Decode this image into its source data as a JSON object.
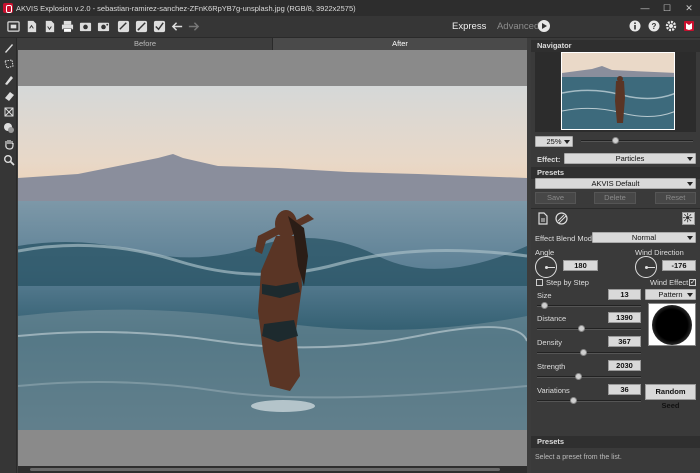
{
  "window": {
    "title": "AKVIS Explosion v.2.0 - sebastian-ramirez-sanchez-ZFnK6RpYB7g-unsplash.jpg (RGB/8, 3922x2575)"
  },
  "modes": {
    "express": "Express",
    "advanced": "Advanced"
  },
  "view_tabs": {
    "before": "Before",
    "after": "After"
  },
  "navigator": {
    "title": "Navigator",
    "zoom": "25%"
  },
  "effect": {
    "label": "Effect:",
    "value": "Particles"
  },
  "presets": {
    "title": "Presets",
    "value": "AKVIS Default",
    "save": "Save",
    "delete": "Delete",
    "reset": "Reset"
  },
  "blend": {
    "label": "Effect Blend Mode",
    "value": "Normal"
  },
  "angle": {
    "label": "Angle",
    "value": "180"
  },
  "wind_direction": {
    "label": "Wind Direction",
    "value": "-176"
  },
  "step_by_step": {
    "label": "Step by Step",
    "checked": false
  },
  "wind_effect": {
    "label": "Wind Effect",
    "checked": true
  },
  "params": {
    "size": {
      "label": "Size",
      "value": "13"
    },
    "distance": {
      "label": "Distance",
      "value": "1390"
    },
    "density": {
      "label": "Density",
      "value": "367"
    },
    "strength": {
      "label": "Strength",
      "value": "2030"
    },
    "variations": {
      "label": "Variations",
      "value": "36"
    }
  },
  "pattern": {
    "value": "Pattern"
  },
  "random_seed": {
    "label": "Random Seed"
  },
  "presets_panel": {
    "title": "Presets",
    "hint": "Select a preset from the list."
  },
  "colors": {
    "accent_red": "#c8102e",
    "panel_bg": "#3a3a3a",
    "field_bg": "#d9d9d9"
  }
}
